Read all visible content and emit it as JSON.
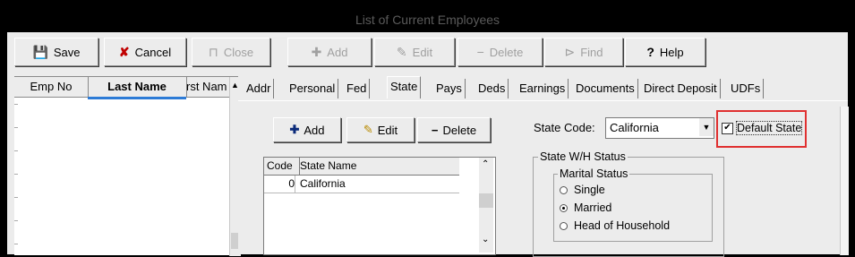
{
  "window": {
    "title": "List of Current Employees"
  },
  "toolbar": {
    "save": "Save",
    "cancel": "Cancel",
    "close": "Close",
    "add": "Add",
    "edit": "Edit",
    "delete": "Delete",
    "find": "Find",
    "help": "Help"
  },
  "grid": {
    "columns": [
      "Emp No",
      "Last Name",
      "rst Nam"
    ]
  },
  "tabs": [
    "Addr",
    "Personal",
    "Fed",
    "State",
    "Pays",
    "Deds",
    "Earnings",
    "Documents",
    "Direct Deposit",
    "UDFs"
  ],
  "state_panel": {
    "add": "Add",
    "edit": "Edit",
    "delete": "Delete",
    "list_headers": [
      "Code",
      "State Name"
    ],
    "rows": [
      {
        "code": "0",
        "name": "California"
      }
    ],
    "state_code_label": "State Code:",
    "state_code_value": "California",
    "default_state_label": "Default State",
    "default_state_checked": true,
    "wh_status_label": "State W/H Status",
    "marital_status_label": "Marital Status",
    "marital_options": [
      "Single",
      "Married",
      "Head of Household"
    ],
    "marital_selected": "Married"
  },
  "colors": {
    "highlight_box": "#e03030",
    "selection_blue": "#2d7bd6"
  }
}
